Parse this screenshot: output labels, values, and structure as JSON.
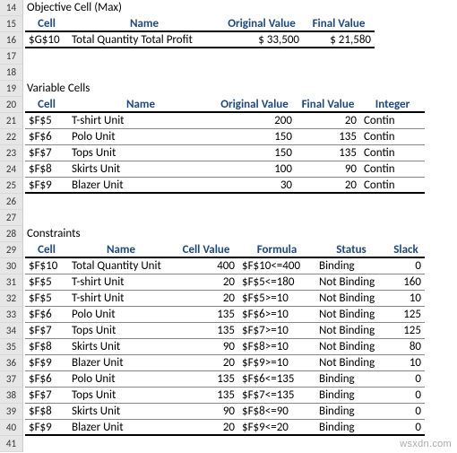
{
  "row_start": 14,
  "row_end": 41,
  "sections": {
    "objective": {
      "title": "Objective Cell (Max)",
      "headers": {
        "cell": "Cell",
        "name": "Name",
        "orig": "Original Value",
        "final": "Final Value"
      },
      "rows": [
        {
          "cell": "$G$10",
          "name": "Total Quantity Total Profit",
          "orig": "$       33,500",
          "final": "$     21,580"
        }
      ]
    },
    "variables": {
      "title": "Variable Cells",
      "headers": {
        "cell": "Cell",
        "name": "Name",
        "orig": "Original Value",
        "final": "Final Value",
        "int": "Integer"
      },
      "rows": [
        {
          "cell": "$F$5",
          "name": "T-shirt Unit",
          "orig": "200",
          "final": "20",
          "int": "Contin"
        },
        {
          "cell": "$F$6",
          "name": "Polo Unit",
          "orig": "150",
          "final": "135",
          "int": "Contin"
        },
        {
          "cell": "$F$7",
          "name": "Tops Unit",
          "orig": "150",
          "final": "135",
          "int": "Contin"
        },
        {
          "cell": "$F$8",
          "name": "Skirts Unit",
          "orig": "100",
          "final": "90",
          "int": "Contin"
        },
        {
          "cell": "$F$9",
          "name": "Blazer Unit",
          "orig": "30",
          "final": "20",
          "int": "Contin"
        }
      ]
    },
    "constraints": {
      "title": "Constraints",
      "headers": {
        "cell": "Cell",
        "name": "Name",
        "val": "Cell Value",
        "formula": "Formula",
        "status": "Status",
        "slack": "Slack"
      },
      "rows": [
        {
          "cell": "$F$10",
          "name": "Total Quantity Unit",
          "val": "400",
          "formula": "$F$10<=400",
          "status": "Binding",
          "slack": "0"
        },
        {
          "cell": "$F$5",
          "name": "T-shirt Unit",
          "val": "20",
          "formula": "$F$5<=180",
          "status": "Not Binding",
          "slack": "160"
        },
        {
          "cell": "$F$5",
          "name": "T-shirt Unit",
          "val": "20",
          "formula": "$F$5>=10",
          "status": "Not Binding",
          "slack": "10"
        },
        {
          "cell": "$F$6",
          "name": "Polo Unit",
          "val": "135",
          "formula": "$F$6>=10",
          "status": "Not Binding",
          "slack": "125"
        },
        {
          "cell": "$F$7",
          "name": "Tops Unit",
          "val": "135",
          "formula": "$F$7>=10",
          "status": "Not Binding",
          "slack": "125"
        },
        {
          "cell": "$F$8",
          "name": "Skirts Unit",
          "val": "90",
          "formula": "$F$8>=10",
          "status": "Not Binding",
          "slack": "80"
        },
        {
          "cell": "$F$9",
          "name": "Blazer Unit",
          "val": "20",
          "formula": "$F$9>=10",
          "status": "Not Binding",
          "slack": "10"
        },
        {
          "cell": "$F$6",
          "name": "Polo Unit",
          "val": "135",
          "formula": "$F$6<=135",
          "status": "Binding",
          "slack": "0"
        },
        {
          "cell": "$F$7",
          "name": "Tops Unit",
          "val": "135",
          "formula": "$F$7<=135",
          "status": "Binding",
          "slack": "0"
        },
        {
          "cell": "$F$8",
          "name": "Skirts Unit",
          "val": "90",
          "formula": "$F$8<=90",
          "status": "Binding",
          "slack": "0"
        },
        {
          "cell": "$F$9",
          "name": "Blazer Unit",
          "val": "20",
          "formula": "$F$9<=20",
          "status": "Binding",
          "slack": "0"
        }
      ]
    }
  },
  "watermark": "wsxdn.com"
}
